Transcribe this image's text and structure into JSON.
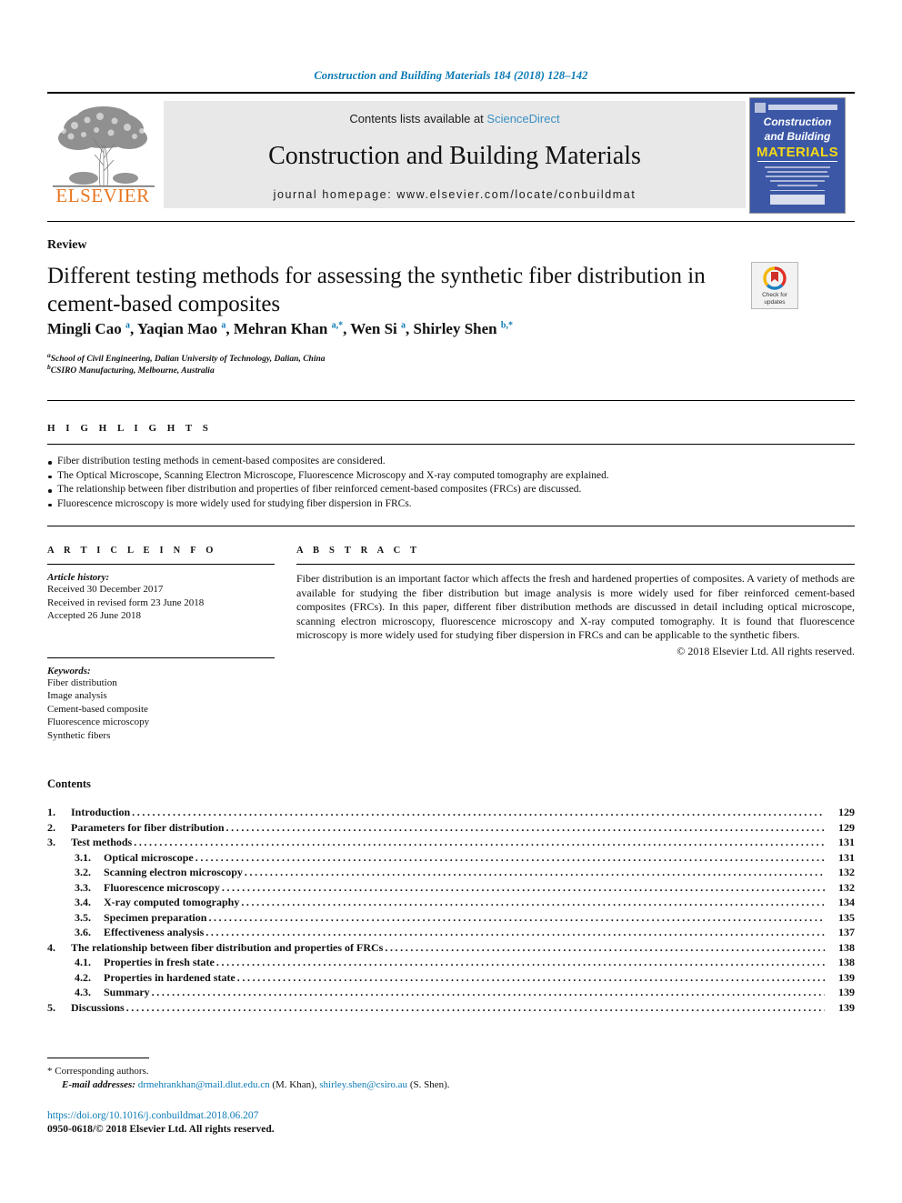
{
  "running_head": "Construction and Building Materials 184 (2018) 128–142",
  "masthead": {
    "publisher_name": "ELSEVIER",
    "contents_prefix": "Contents lists available at ",
    "sciencedirect": "ScienceDirect",
    "journal_title": "Construction and Building Materials",
    "homepage": "journal homepage: www.elsevier.com/locate/conbuildmat",
    "cover": {
      "line1": "Construction",
      "line2": "and Building",
      "line3": "MATERIALS"
    }
  },
  "article": {
    "kicker": "Review",
    "title": "Different testing methods for assessing the synthetic fiber distribution in cement-based composites",
    "crossmark": {
      "line1": "Check for",
      "line2": "updates"
    },
    "authors_html": "Mingli Cao <sup>a</sup>, Yaqian Mao <sup>a</sup>, Mehran Khan <sup>a,*</sup>, Wen Si <sup>a</sup>, Shirley Shen <sup>b,*</sup>",
    "affiliation_a": "School of Civil Engineering, Dalian University of Technology, Dalian, China",
    "affiliation_b": "CSIRO Manufacturing, Melbourne, Australia"
  },
  "highlights": {
    "heading": "H I G H L I G H T S",
    "items": [
      "Fiber distribution testing methods in cement-based composites are considered.",
      "The Optical Microscope, Scanning Electron Microscope, Fluorescence Microscopy and X-ray computed tomography are explained.",
      "The relationship between fiber distribution and properties of fiber reinforced cement-based composites (FRCs) are discussed.",
      "Fluorescence microscopy is more widely used for studying fiber dispersion in FRCs."
    ]
  },
  "article_info": {
    "heading": "A R T I C L E   I N F O",
    "history_label": "Article history:",
    "history": [
      "Received 30 December 2017",
      "Received in revised form 23 June 2018",
      "Accepted 26 June 2018"
    ],
    "keywords_label": "Keywords:",
    "keywords": [
      "Fiber distribution",
      "Image analysis",
      "Cement-based composite",
      "Fluorescence microscopy",
      "Synthetic fibers"
    ]
  },
  "abstract": {
    "heading": "A B S T R A C T",
    "body": "Fiber distribution is an important factor which affects the fresh and hardened properties of composites. A variety of methods are available for studying the fiber distribution but image analysis is more widely used for fiber reinforced cement-based composites (FRCs). In this paper, different fiber distribution methods are discussed in detail including optical microscope, scanning electron microscopy, fluorescence microscopy and X-ray computed tomography. It is found that fluorescence microscopy is more widely used for studying fiber dispersion in FRCs and can be applicable to the synthetic fibers.",
    "copyright": "© 2018 Elsevier Ltd. All rights reserved."
  },
  "contents": {
    "heading": "Contents",
    "entries": [
      {
        "level": 1,
        "number": "1.",
        "label": "Introduction",
        "page": "129"
      },
      {
        "level": 1,
        "number": "2.",
        "label": "Parameters for fiber distribution",
        "page": "129"
      },
      {
        "level": 1,
        "number": "3.",
        "label": "Test methods",
        "page": "131"
      },
      {
        "level": 2,
        "number": "3.1.",
        "label": "Optical microscope",
        "page": "131"
      },
      {
        "level": 2,
        "number": "3.2.",
        "label": "Scanning electron microscopy",
        "page": "132"
      },
      {
        "level": 2,
        "number": "3.3.",
        "label": "Fluorescence microscopy",
        "page": "132"
      },
      {
        "level": 2,
        "number": "3.4.",
        "label": "X-ray computed tomography",
        "page": "134"
      },
      {
        "level": 2,
        "number": "3.5.",
        "label": "Specimen preparation",
        "page": "135"
      },
      {
        "level": 2,
        "number": "3.6.",
        "label": "Effectiveness analysis",
        "page": "137"
      },
      {
        "level": 1,
        "number": "4.",
        "label": "The relationship between fiber distribution and properties of FRCs",
        "page": "138"
      },
      {
        "level": 2,
        "number": "4.1.",
        "label": "Properties in fresh state",
        "page": "138"
      },
      {
        "level": 2,
        "number": "4.2.",
        "label": "Properties in hardened state",
        "page": "139"
      },
      {
        "level": 2,
        "number": "4.3.",
        "label": "Summary",
        "page": "139"
      },
      {
        "level": 1,
        "number": "5.",
        "label": "Discussions",
        "page": "139"
      }
    ]
  },
  "footnotes": {
    "corresponding": "* Corresponding authors.",
    "email_label": "E-mail addresses:",
    "email_1": "drmehrankhan@mail.dlut.edu.cn",
    "email_1_owner": "(M. Khan),",
    "email_2": "shirley.shen@csiro.au",
    "email_2_owner": "(S. Shen).",
    "doi": "https://doi.org/10.1016/j.conbuildmat.2018.06.207",
    "issn": "0950-0618/© 2018 Elsevier Ltd. All rights reserved."
  },
  "colors": {
    "link": "#0b7ab5",
    "elsevier_orange": "#e87722",
    "cover_blue": "#3b57a6",
    "cover_yellow": "#f5d916"
  }
}
